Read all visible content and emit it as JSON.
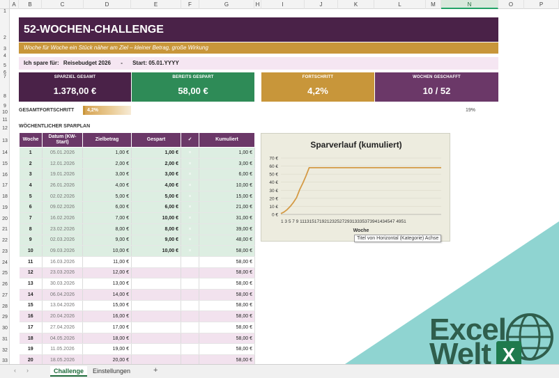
{
  "columns": [
    "A",
    "B",
    "C",
    "D",
    "E",
    "F",
    "G",
    "H",
    "I",
    "J",
    "K",
    "L",
    "M",
    "N",
    "O",
    "P"
  ],
  "selected_column": "N",
  "rows": [
    "1",
    "2",
    "3",
    "4",
    "5",
    "6",
    "7",
    "8",
    "9",
    "10",
    "11",
    "12",
    "13",
    "14",
    "15",
    "16",
    "17",
    "18",
    "19",
    "20",
    "21",
    "22",
    "23",
    "24",
    "25",
    "26",
    "27",
    "28",
    "29",
    "30",
    "31",
    "32",
    "33"
  ],
  "header": {
    "title": "52-WOCHEN-CHALLENGE",
    "subtitle": "Woche für Woche ein Stück näher am Ziel – kleiner Betrag, große Wirkung",
    "spare_label": "Ich spare für:",
    "spare_value": "Reisebudget 2026",
    "separator": "-",
    "start_label": "Start: 05.01.YYYY"
  },
  "kpis": [
    {
      "label": "SPARZIEL GESAMT",
      "value": "1.378,00 €",
      "color": "#4a2248"
    },
    {
      "label": "BEREITS GESPART",
      "value": "58,00 €",
      "color": "#2e8b57"
    },
    {
      "label": "FORTSCHRITT",
      "value": "4,2%",
      "color": "#c8963a"
    },
    {
      "label": "WOCHEN GESCHAFFT",
      "value": "10 / 52",
      "color": "#6b3868"
    }
  ],
  "progress": {
    "label": "GESAMTFORTSCHRITT",
    "value_text": "4,2%",
    "fraction": 0.042,
    "right_text": "19%"
  },
  "section_title": "WÖCHENTLICHER SPARPLAN",
  "table": {
    "headers": [
      "Woche",
      "Datum (KW-Start)",
      "Zielbetrag",
      "Gespart",
      "✓",
      "Kumuliert"
    ],
    "rows": [
      {
        "woche": "1",
        "datum": "05.01.2026",
        "ziel": "1,00 €",
        "gespart": "1,00 €",
        "check": "×",
        "kum": "1,00 €"
      },
      {
        "woche": "2",
        "datum": "12.01.2026",
        "ziel": "2,00 €",
        "gespart": "2,00 €",
        "check": "×",
        "kum": "3,00 €"
      },
      {
        "woche": "3",
        "datum": "19.01.2026",
        "ziel": "3,00 €",
        "gespart": "3,00 €",
        "check": "×",
        "kum": "6,00 €"
      },
      {
        "woche": "4",
        "datum": "26.01.2026",
        "ziel": "4,00 €",
        "gespart": "4,00 €",
        "check": "×",
        "kum": "10,00 €"
      },
      {
        "woche": "5",
        "datum": "02.02.2026",
        "ziel": "5,00 €",
        "gespart": "5,00 €",
        "check": "×",
        "kum": "15,00 €"
      },
      {
        "woche": "6",
        "datum": "09.02.2026",
        "ziel": "6,00 €",
        "gespart": "6,00 €",
        "check": "×",
        "kum": "21,00 €"
      },
      {
        "woche": "7",
        "datum": "16.02.2026",
        "ziel": "7,00 €",
        "gespart": "10,00 €",
        "check": "×",
        "kum": "31,00 €"
      },
      {
        "woche": "8",
        "datum": "23.02.2026",
        "ziel": "8,00 €",
        "gespart": "8,00 €",
        "check": "×",
        "kum": "39,00 €"
      },
      {
        "woche": "9",
        "datum": "02.03.2026",
        "ziel": "9,00 €",
        "gespart": "9,00 €",
        "check": "×",
        "kum": "48,00 €"
      },
      {
        "woche": "10",
        "datum": "09.03.2026",
        "ziel": "10,00 €",
        "gespart": "10,00 €",
        "check": "×",
        "kum": "58,00 €"
      },
      {
        "woche": "11",
        "datum": "16.03.2026",
        "ziel": "11,00 €",
        "gespart": "",
        "check": "",
        "kum": "58,00 €"
      },
      {
        "woche": "12",
        "datum": "23.03.2026",
        "ziel": "12,00 €",
        "gespart": "",
        "check": "",
        "kum": "58,00 €"
      },
      {
        "woche": "13",
        "datum": "30.03.2026",
        "ziel": "13,00 €",
        "gespart": "",
        "check": "",
        "kum": "58,00 €"
      },
      {
        "woche": "14",
        "datum": "06.04.2026",
        "ziel": "14,00 €",
        "gespart": "",
        "check": "",
        "kum": "58,00 €"
      },
      {
        "woche": "15",
        "datum": "13.04.2026",
        "ziel": "15,00 €",
        "gespart": "",
        "check": "",
        "kum": "58,00 €"
      },
      {
        "woche": "16",
        "datum": "20.04.2026",
        "ziel": "16,00 €",
        "gespart": "",
        "check": "",
        "kum": "58,00 €"
      },
      {
        "woche": "17",
        "datum": "27.04.2026",
        "ziel": "17,00 €",
        "gespart": "",
        "check": "",
        "kum": "58,00 €"
      },
      {
        "woche": "18",
        "datum": "04.05.2026",
        "ziel": "18,00 €",
        "gespart": "",
        "check": "",
        "kum": "58,00 €"
      },
      {
        "woche": "19",
        "datum": "11.05.2026",
        "ziel": "19,00 €",
        "gespart": "",
        "check": "",
        "kum": "58,00 €"
      },
      {
        "woche": "20",
        "datum": "18.05.2026",
        "ziel": "20,00 €",
        "gespart": "",
        "check": "",
        "kum": "58,00 €"
      }
    ]
  },
  "chart_data": {
    "type": "line",
    "title": "Sparverlauf (kumuliert)",
    "xlabel": "Woche",
    "ylabel": "",
    "ylim": [
      0,
      70
    ],
    "y_ticks": [
      "0 €",
      "10 €",
      "20 €",
      "30 €",
      "40 €",
      "50 €",
      "60 €",
      "70 €"
    ],
    "x_tick_text": "1 3 5 7 9 11131517192123252729313335373941434547 4951",
    "x": [
      1,
      2,
      3,
      4,
      5,
      6,
      7,
      8,
      9,
      10,
      11,
      12,
      13,
      14,
      15,
      16,
      17,
      18,
      19,
      20,
      21,
      22,
      23,
      24,
      25,
      26,
      27,
      28,
      29,
      30,
      31,
      32,
      33,
      34,
      35,
      36,
      37,
      38,
      39,
      40,
      41,
      42,
      43,
      44,
      45,
      46,
      47,
      48,
      49,
      50,
      51,
      52
    ],
    "series": [
      {
        "values": [
          1,
          3,
          6,
          10,
          15,
          21,
          31,
          39,
          48,
          58,
          58,
          58,
          58,
          58,
          58,
          58,
          58,
          58,
          58,
          58,
          58,
          58,
          58,
          58,
          58,
          58,
          58,
          58,
          58,
          58,
          58,
          58,
          58,
          58,
          58,
          58,
          58,
          58,
          58,
          58,
          58,
          58,
          58,
          58,
          58,
          58,
          58,
          58,
          58,
          58,
          58,
          58
        ],
        "color": "#d49a45"
      }
    ],
    "grid": true,
    "legend": "none"
  },
  "tooltip": "Titel von Horizontal (Kategorie) Achse",
  "logo": {
    "line1": "Excel",
    "line2": "Welt",
    "badge": "X"
  },
  "tabs": {
    "prev": "‹",
    "next": "›",
    "sheets": [
      "Challenge",
      "Einstellungen"
    ],
    "add": "+"
  },
  "colors": {
    "purple_dark": "#4a2248",
    "purple": "#6b3868",
    "gold": "#c8963a",
    "green": "#2e8b57",
    "teal": "#8fd4d1",
    "logo_green": "#2f5e4c"
  }
}
